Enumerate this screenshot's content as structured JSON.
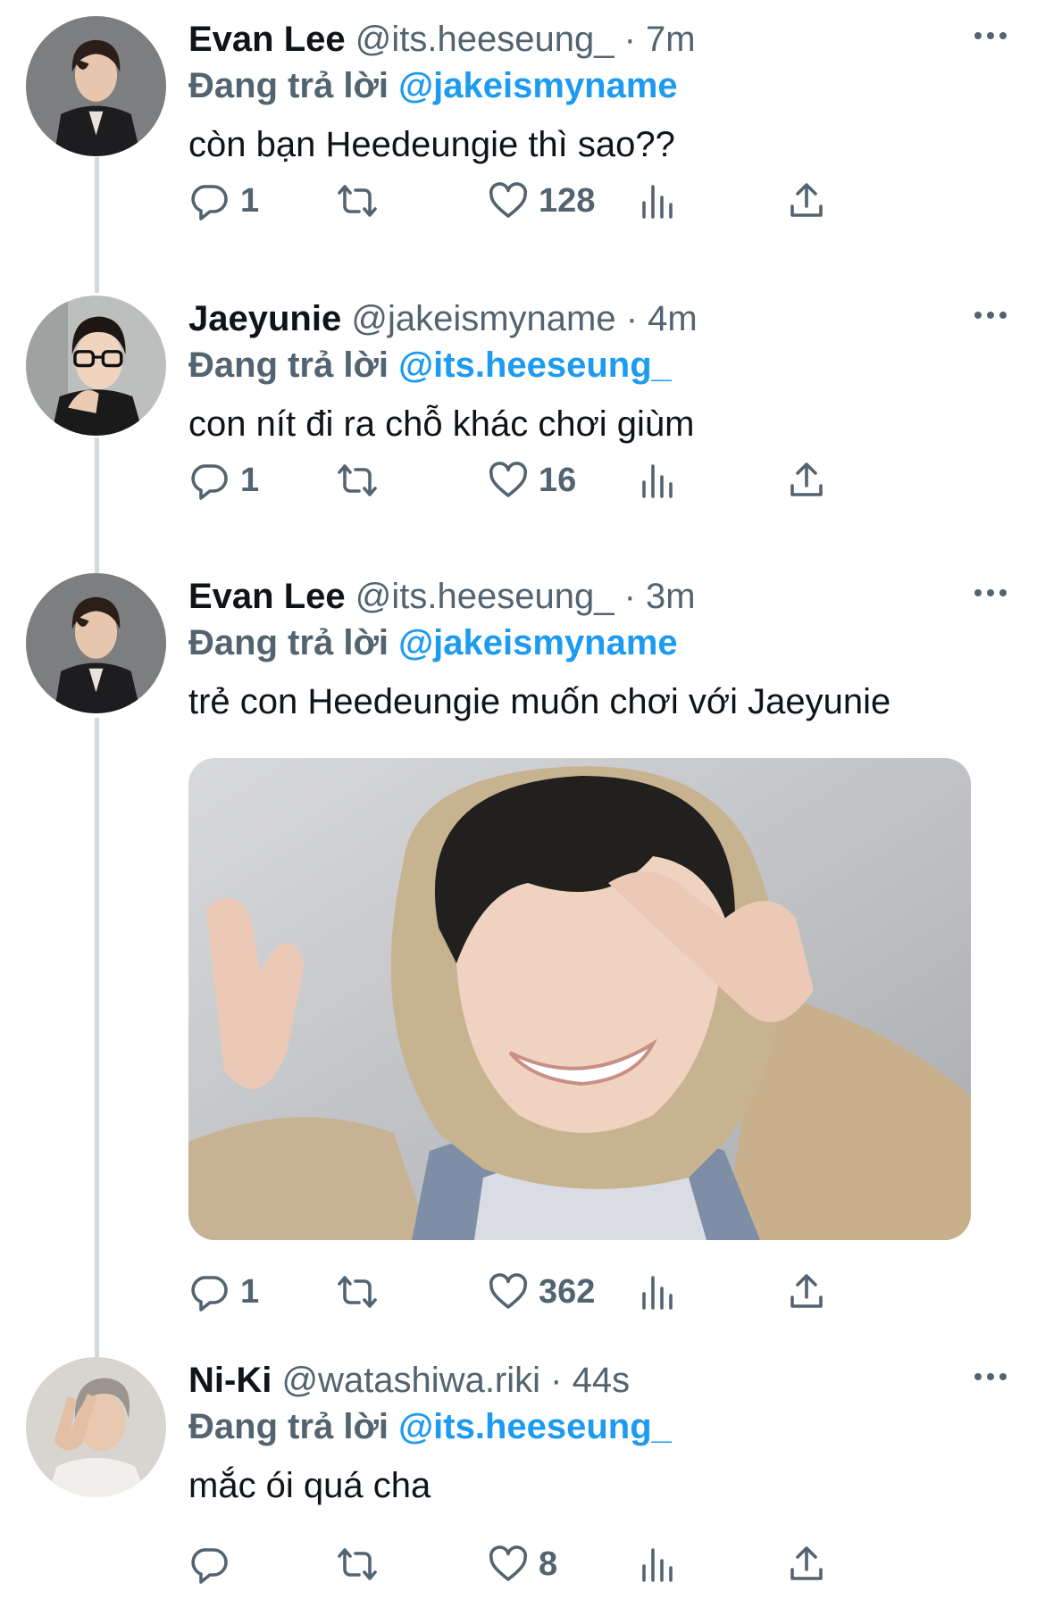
{
  "replying_prefix": "Đang trả lời",
  "tweets": [
    {
      "name": "Evan Lee",
      "handle": "@its.heeseung_",
      "separator": "·",
      "time": "7m",
      "reply_to": "@jakeismyname",
      "text": "còn bạn Heedeungie thì sao??",
      "replies": "1",
      "likes": "128",
      "avatar": "portrait-dark-jacket"
    },
    {
      "name": "Jaeyunie",
      "handle": "@jakeismyname",
      "separator": "·",
      "time": "4m",
      "reply_to": "@its.heeseung_",
      "text": "con nít đi ra chỗ khác chơi giùm",
      "replies": "1",
      "likes": "16",
      "avatar": "portrait-glasses"
    },
    {
      "name": "Evan Lee",
      "handle": "@its.heeseung_",
      "separator": "·",
      "time": "3m",
      "reply_to": "@jakeismyname",
      "text": "trẻ con Heedeungie muốn chơi với Jaeyunie",
      "replies": "1",
      "likes": "362",
      "avatar": "portrait-dark-jacket",
      "media": "photo-person-fleece-hood"
    },
    {
      "name": "Ni-Ki",
      "handle": "@watashiwa.riki",
      "separator": "·",
      "time": "44s",
      "reply_to": "@its.heeseung_",
      "text": "mắc ói quá cha",
      "replies": "",
      "likes": "8",
      "avatar": "portrait-peace-sign"
    }
  ],
  "icons": {
    "reply": "reply-icon",
    "retweet": "retweet-icon",
    "like": "heart-icon",
    "views": "views-icon",
    "share": "share-icon",
    "more": "more-icon"
  },
  "colors": {
    "text": "#0f1419",
    "secondary": "#536471",
    "link": "#1d9bf0",
    "thread_line": "#cfd9de"
  }
}
